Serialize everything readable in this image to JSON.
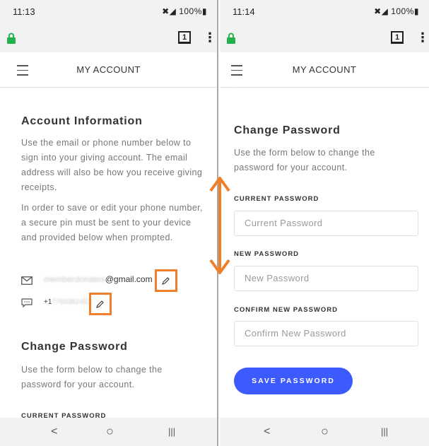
{
  "left": {
    "status": {
      "time": "11:13",
      "icons": "✖◢ 100%▮"
    },
    "tab_count": "1",
    "header": {
      "title": "MY ACCOUNT"
    },
    "account_info": {
      "heading": "Account Information",
      "para1": "Use the email or phone number below to sign into your giving account. The email address will also be how you receive giving receipts.",
      "para2": "In order to save or edit your phone number, a secure pin must be sent to your device and provided below when prompted.",
      "email_blurred": "memberdonates",
      "email_domain": "@gmail.com",
      "phone_prefix": "+1",
      "phone_blurred": "7765382451"
    },
    "change_password": {
      "heading": "Change Password",
      "desc": "Use the form below to change the password for your account.",
      "current_label": "CURRENT PASSWORD"
    }
  },
  "right": {
    "status": {
      "time": "11:14",
      "icons": "✖◢ 100%▮"
    },
    "tab_count": "1",
    "header": {
      "title": "MY ACCOUNT"
    },
    "change_password": {
      "heading": "Change Password",
      "desc": "Use the form below to change the password for your account.",
      "current_label": "CURRENT PASSWORD",
      "current_placeholder": "Current Password",
      "new_label": "NEW PASSWORD",
      "new_placeholder": "New Password",
      "confirm_label": "CONFIRM NEW PASSWORD",
      "confirm_placeholder": "Confirm New Password",
      "save_label": "SAVE PASSWORD"
    }
  },
  "nav": {
    "back": "<",
    "home": "○",
    "recents": "|||"
  },
  "colors": {
    "accent_button": "#3d5afe",
    "highlight": "#f07f2b",
    "lock": "#22b14c"
  },
  "icons": [
    "lock-icon",
    "tabs-icon",
    "more-vert-icon",
    "hamburger-icon",
    "mail-icon",
    "chat-icon",
    "pencil-icon",
    "double-arrow-icon"
  ]
}
